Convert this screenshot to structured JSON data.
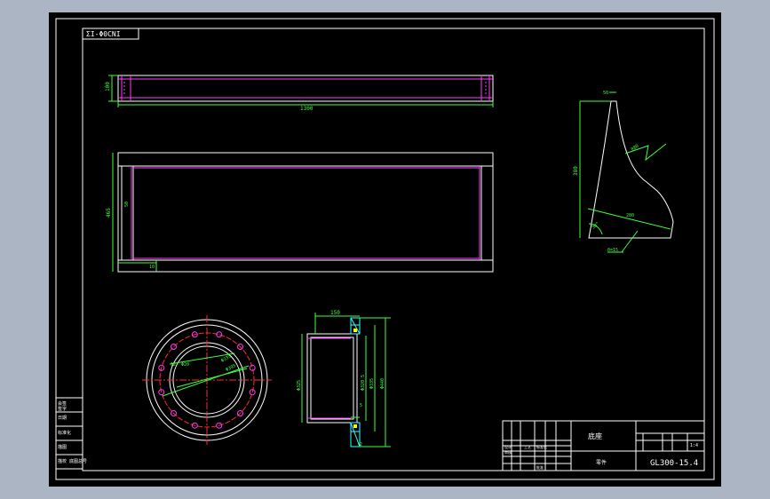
{
  "drawing": {
    "drawing_number_box": "ΣI-Φ0CNI",
    "title_block": {
      "part_name": "底座",
      "part_type": "零件",
      "drawing_number": "GL300-15.4",
      "scale": "1:4",
      "small_labels": [
        "设计",
        "审核",
        "工艺",
        "标准化",
        "批准"
      ]
    },
    "dims": {
      "top_view_height": "100",
      "top_view_length": "1300",
      "front_height": "465",
      "front_inner": "50",
      "front_base": "10",
      "circle_holes": "12- Φ20",
      "circle_d1": "Φ335",
      "circle_d2": "Φ395",
      "section_width": "150",
      "section_d1": "Φ320 5",
      "section_d2": "Φ335",
      "section_d3": "Φ440",
      "section_left": "Φ325",
      "section_small": "5",
      "section_bottom": "2",
      "rib_top": "50",
      "rib_height": "380",
      "rib_diag": "280",
      "rib_r": "R80",
      "rib_angle": "30°",
      "rib_thickness": "δ=15"
    },
    "side_labels": [
      "会签",
      "签字",
      "日期",
      "标准化",
      "描图",
      "描校",
      "底图总号"
    ],
    "colors": {
      "line": "#ffffff",
      "magenta": "#ff3cff",
      "green": "#3cff3c",
      "red": "#ff2a2a",
      "cyan": "#33ffff",
      "yellow": "#ffff00"
    }
  }
}
